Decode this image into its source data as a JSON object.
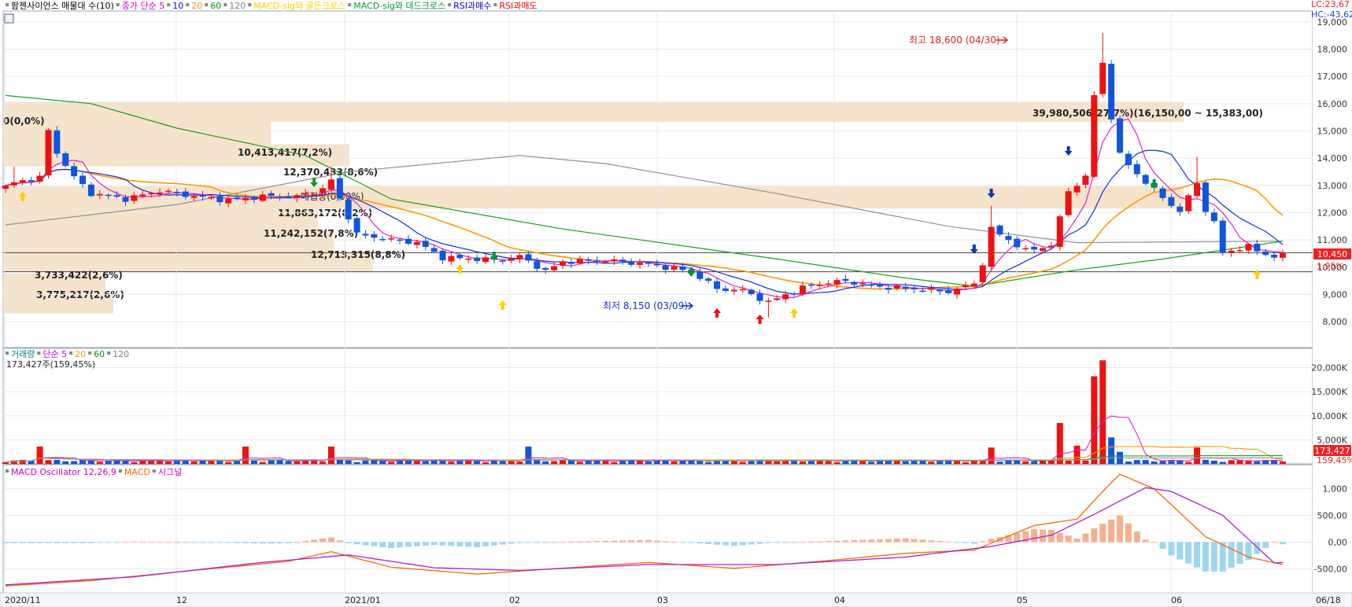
{
  "legend": {
    "price": [
      {
        "text": "팜젠사이언스 매물대 수(10)",
        "color": "#000000"
      },
      {
        "text": "종가 단순 5",
        "color": "#cc00cc"
      },
      {
        "text": "10",
        "color": "#0000ff"
      },
      {
        "text": "20",
        "color": "#ff9900"
      },
      {
        "text": "60",
        "color": "#009900"
      },
      {
        "text": "120",
        "color": "#808080"
      },
      {
        "text": "MACD-sig와 골든크로스",
        "color": "#ffcc00"
      },
      {
        "text": "MACD-sig와 데드크로스",
        "color": "#009933"
      },
      {
        "text": "RSI과매수",
        "color": "#0000cc"
      },
      {
        "text": "RSI과매도",
        "color": "#ee0000"
      }
    ],
    "volume": [
      {
        "text": "거래량",
        "color": "#008080"
      },
      {
        "text": "단순 5",
        "color": "#cc00cc"
      },
      {
        "text": "20",
        "color": "#ff9900"
      },
      {
        "text": "60",
        "color": "#009900"
      },
      {
        "text": "120",
        "color": "#808080"
      }
    ],
    "volume_value": "173,427주(159,45%)",
    "macd": [
      {
        "text": "MACD Oscillator 12,26,9",
        "color": "#cc00cc"
      },
      {
        "text": "MACD",
        "color": "#ff6600"
      },
      {
        "text": "시그널",
        "color": "#cc00cc"
      }
    ]
  },
  "corner": {
    "lc": "LC:23,67",
    "hc": "HC:-43,62"
  },
  "badges": {
    "price": "10,450",
    "price_pct": "1,95%",
    "volume": "173,427",
    "volume_pct": "159,45%"
  },
  "annotations": {
    "high": "최고 18,600 (04/30)",
    "low": "최저 8,150 (03/09)"
  },
  "chart_data": [
    {
      "type": "candlestick",
      "panel": "price",
      "y_ticks": [
        8000,
        9000,
        10000,
        11000,
        12000,
        13000,
        14000,
        15000,
        16000,
        17000,
        18000,
        19000
      ],
      "y_tick_labels": [
        "8,000",
        "9,000",
        "10,000",
        "11,000",
        "12,000",
        "13,000",
        "14,000",
        "15,000",
        "16,000",
        "17,000",
        "18,000",
        "19,000"
      ],
      "ylim": [
        7050,
        19400
      ],
      "x_labels": [
        "2020/11",
        "12",
        "2021/01",
        "02",
        "03",
        "04",
        "05",
        "06",
        "06/18"
      ],
      "last_price": 10450,
      "high": 18600,
      "low": 8150,
      "volume_profile": [
        {
          "label": "0(0,0%)",
          "low": 15330,
          "high": 16070
        },
        {
          "label": "10,413,417(7,2%)",
          "low": 14510,
          "high": 15330
        },
        {
          "label": "12,370,433(8,6%)",
          "low": 13700,
          "high": 14510
        },
        {
          "label": "39,980,506(27,7%)(16,150,00 ~ 15,383,00)",
          "low": 12150,
          "high": 12970
        },
        {
          "label": "11,863,172(8,2%)",
          "low": 11350,
          "high": 12150
        },
        {
          "label": "11,242,152(7,8%)",
          "low": 10530,
          "high": 11350
        },
        {
          "label": "12,713,315(8,8%)",
          "low": 9830,
          "high": 10530
        },
        {
          "label": "3,733,422(2,6%)",
          "low": 9020,
          "high": 9760
        },
        {
          "label": "3,775,217(2,6%)",
          "low": 8300,
          "high": 9020
        }
      ],
      "marker_label": "매집량(0,00%)"
    },
    {
      "type": "bar",
      "panel": "volume",
      "y_ticks": [
        5000,
        10000,
        15000,
        20000
      ],
      "y_tick_labels": [
        "5,000K",
        "10,000K",
        "15,000K",
        "20,000K"
      ],
      "ylim": [
        0,
        24000
      ],
      "last_volume": 173427
    },
    {
      "type": "bar_line",
      "panel": "macd",
      "y_ticks": [
        -500,
        0,
        500,
        1000
      ],
      "y_tick_labels": [
        "-500,00",
        "0,00",
        "500,00",
        "1,000"
      ],
      "ylim": [
        -950,
        1450
      ]
    }
  ]
}
